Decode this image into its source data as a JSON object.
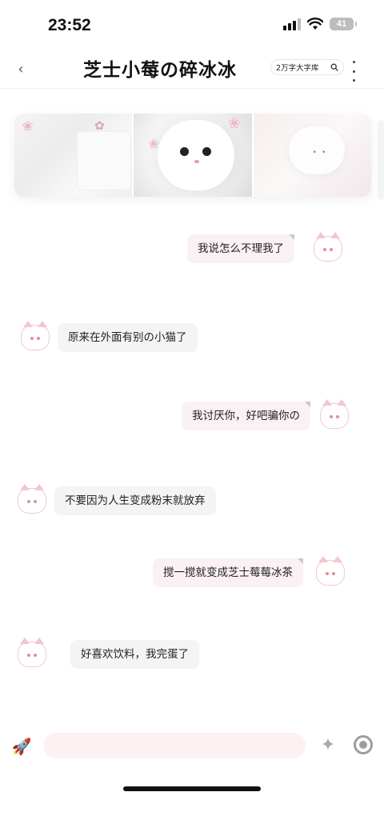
{
  "status_bar": {
    "time": "23:52",
    "battery": "41"
  },
  "header": {
    "title": "芝士小莓の碎冰冰",
    "font_pill_label": "2万字大字库",
    "icons": [
      "back-chevron-icon",
      "search-icon",
      "more-vertical-icon"
    ]
  },
  "banner": {
    "images": [
      "bow-and-card-photo",
      "white-kitten-photo",
      "plush-toy-photo"
    ]
  },
  "messages": [
    {
      "side": "mine",
      "text": "我说怎么不理我了"
    },
    {
      "side": "other",
      "text": "原来在外面有别の小猫了"
    },
    {
      "side": "mine",
      "text": "我讨厌你，好吧骗你の"
    },
    {
      "side": "other",
      "text": "不要因为人生变成粉末就放弃"
    },
    {
      "side": "mine",
      "text": "搅一搅就变成芝士莓莓冰茶"
    },
    {
      "side": "other",
      "text": "好喜欢饮料，我完蛋了"
    }
  ],
  "input_bar": {
    "value": "",
    "icons": [
      "rocket-icon",
      "sparkle-icon",
      "record-icon"
    ]
  },
  "colors": {
    "bubble_mine": "#fbf1f3",
    "bubble_other": "#f4f4f4",
    "input_bg": "#fdf1f3",
    "avatar_accent": "#f2c7ce"
  }
}
